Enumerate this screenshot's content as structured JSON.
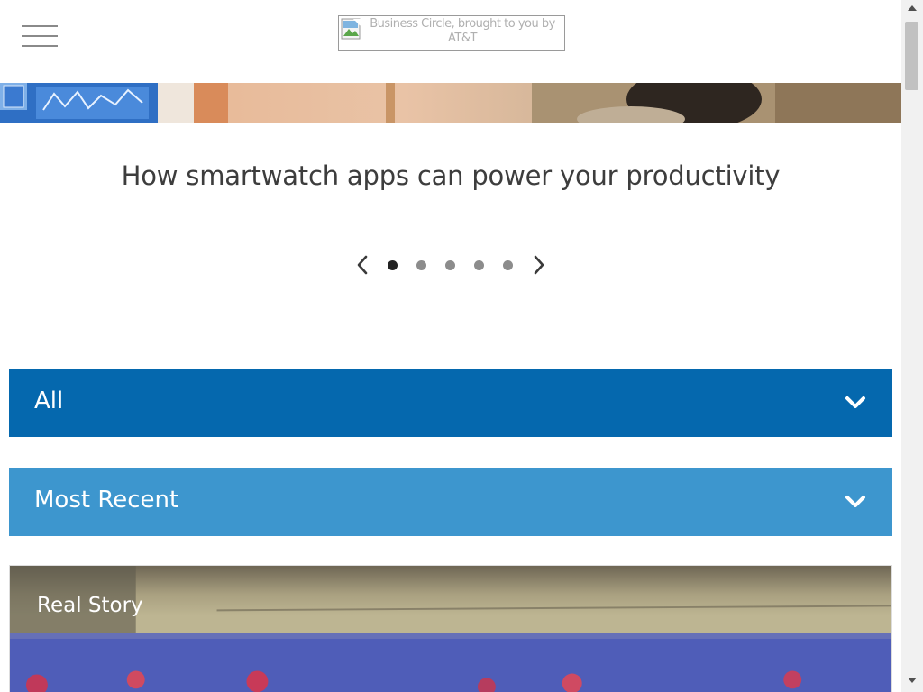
{
  "header": {
    "menu_icon": "hamburger-menu-icon",
    "logo_alt": "Business Circle, brought to you by AT&T"
  },
  "carousel": {
    "slide_title": "How smartwatch apps can power your productivity",
    "slide_count": 5,
    "active_index": 0,
    "prev_icon": "chevron-left-icon",
    "next_icon": "chevron-right-icon"
  },
  "filters": {
    "category": {
      "label": "All",
      "icon": "chevron-down-icon",
      "color": "#0568ae"
    },
    "sort": {
      "label": "Most Recent",
      "icon": "chevron-down-icon",
      "color": "#3d96ce"
    }
  },
  "story": {
    "label": "Real Story"
  },
  "colors": {
    "text_dark": "#3d3d3d",
    "dot_active": "#222222",
    "dot_inactive": "#8c8c8c"
  }
}
